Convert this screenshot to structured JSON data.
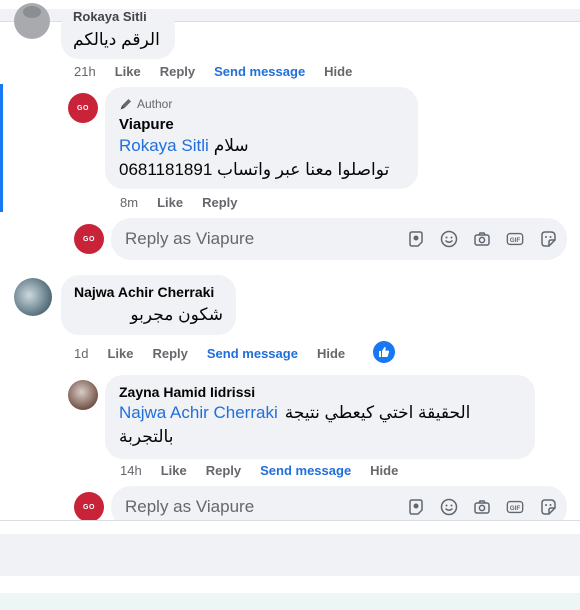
{
  "top_comment": {
    "name": "Rokaya Sitli",
    "text": "الرقم ديالكم",
    "time": "21h",
    "like": "Like",
    "reply": "Reply",
    "send_message": "Send message",
    "hide": "Hide"
  },
  "reply1": {
    "author_badge": "Author",
    "name": "Viapure",
    "mention": "Rokaya Sitli",
    "line1_text": "سلام",
    "line2_text": "تواصلوا معنا عبر واتساب 0681181891",
    "time": "8m",
    "like": "Like",
    "reply": "Reply"
  },
  "reply_box_1": {
    "placeholder": "Reply as Viapure"
  },
  "comment2": {
    "name": "Najwa Achir Cherraki",
    "text": "شكون مجربو",
    "time": "1d",
    "like": "Like",
    "reply": "Reply",
    "send_message": "Send message",
    "hide": "Hide"
  },
  "reply2": {
    "name": "Zayna Hamid Iidrissi",
    "mention": "Najwa Achir Cherraki",
    "line1_text": "الحقيقة اختي كيعطي نتيجة",
    "line2_text": "بالتجربة",
    "time": "14h",
    "like": "Like",
    "reply": "Reply",
    "send_message": "Send message",
    "hide": "Hide"
  },
  "reply_box_2": {
    "placeholder": "Reply as Viapure"
  },
  "brand_logo_text": "GO",
  "colors": {
    "accent": "#216fdb",
    "bubble": "#f0f2f5",
    "brand": "#c9233a",
    "like_blue": "#1877f2",
    "thread_line": "#1877f2"
  },
  "icons": [
    "avatar-sticker-icon",
    "emoji-icon",
    "camera-icon",
    "gif-icon",
    "sticker-icon",
    "like-reaction-icon",
    "pencil-icon"
  ]
}
